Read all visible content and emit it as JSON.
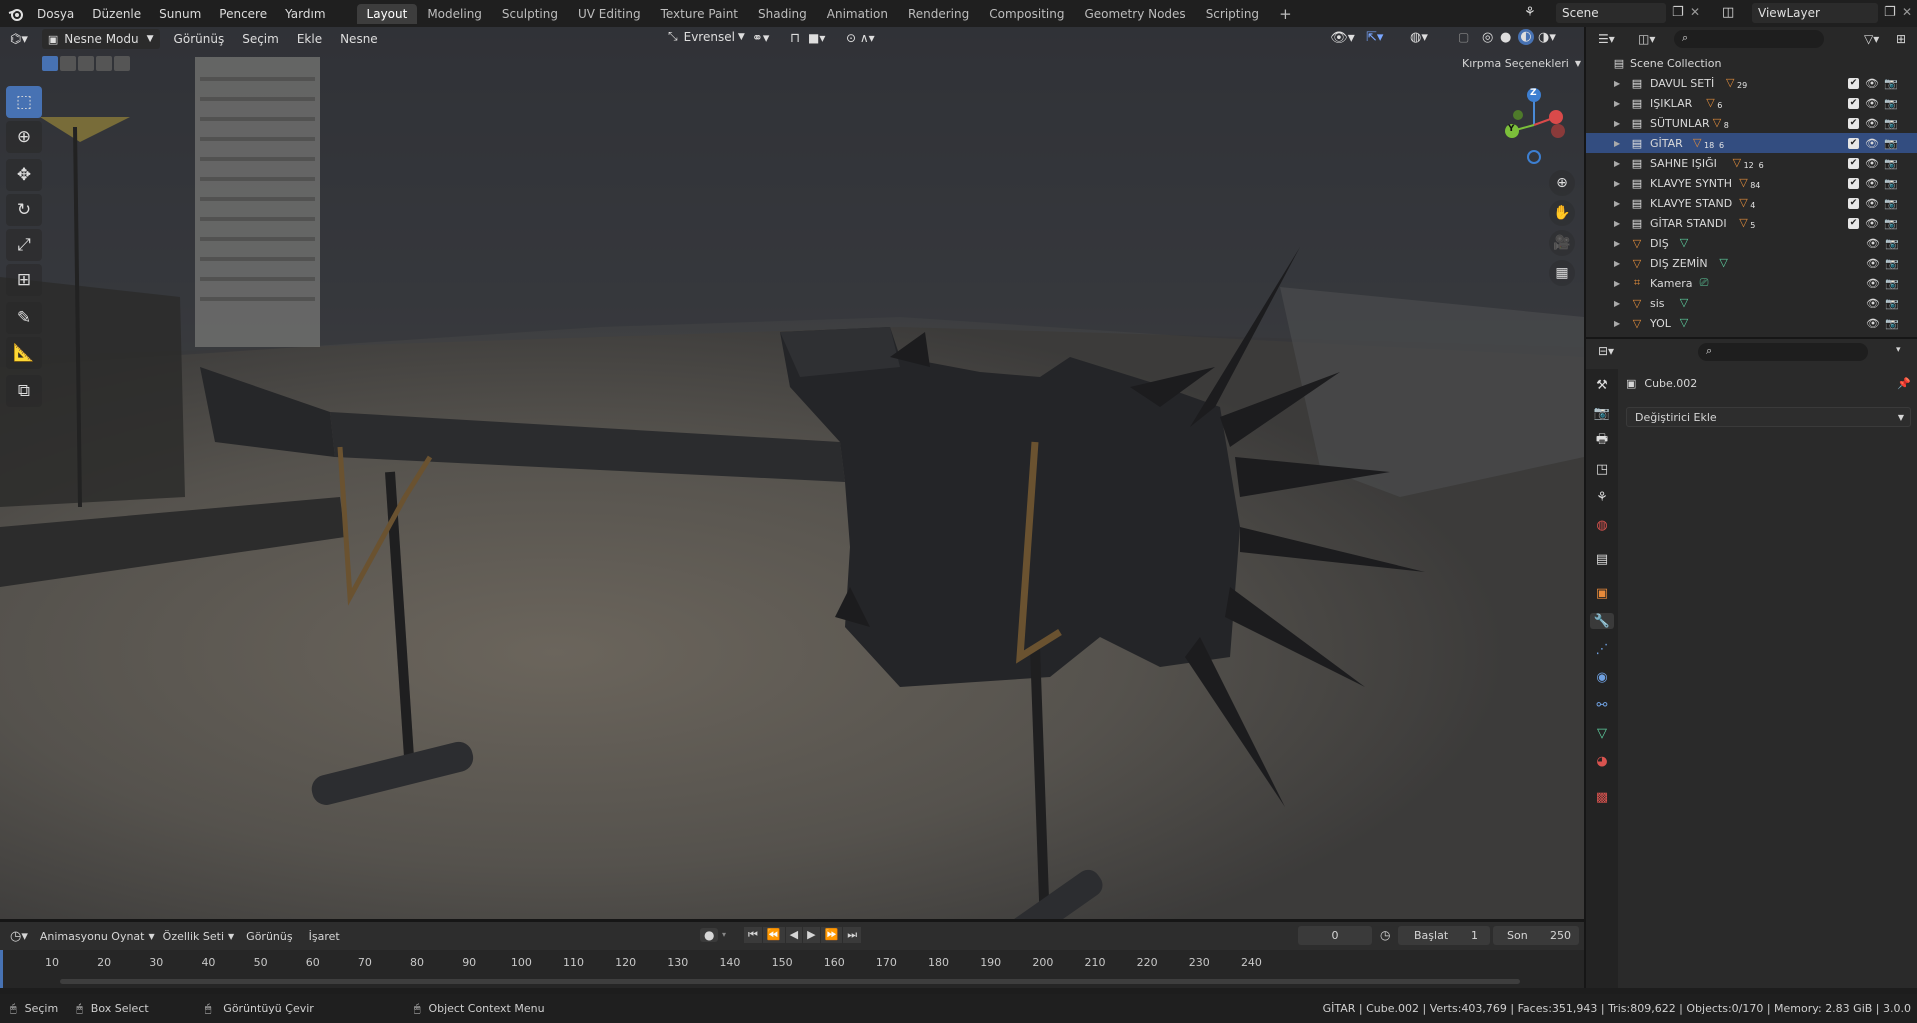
{
  "topbar": {
    "menus": [
      "Dosya",
      "Düzenle",
      "Sunum",
      "Pencere",
      "Yardım"
    ],
    "workspaces": [
      "Layout",
      "Modeling",
      "Sculpting",
      "UV Editing",
      "Texture Paint",
      "Shading",
      "Animation",
      "Rendering",
      "Compositing",
      "Geometry Nodes",
      "Scripting"
    ],
    "active_workspace": "Layout",
    "add_tab": "+",
    "scene": "Scene",
    "view_layer": "ViewLayer"
  },
  "viewport_header": {
    "mode": "Nesne Modu",
    "menus": [
      "Görünüş",
      "Seçim",
      "Ekle",
      "Nesne"
    ],
    "transform_orientation": "Evrensel",
    "clipping_options": "Kırpma Seçenekleri"
  },
  "gizmo": {
    "z": "Z",
    "y": "Y"
  },
  "outliner": {
    "root": "Scene Collection",
    "items": [
      {
        "name": "DAVUL SETİ",
        "badge": "29",
        "type": "collection"
      },
      {
        "name": "IŞIKLAR",
        "badge": "6",
        "type": "collection"
      },
      {
        "name": "SÜTUNLAR",
        "badge": "8",
        "type": "collection"
      },
      {
        "name": "GİTAR",
        "badge": "18",
        "badge2": "6",
        "type": "collection",
        "selected": true
      },
      {
        "name": "SAHNE IŞIĞI",
        "badge": "12",
        "badge2": "6",
        "type": "collection"
      },
      {
        "name": "KLAVYE SYNTH",
        "badge": "84",
        "type": "collection"
      },
      {
        "name": "KLAVYE STAND",
        "badge": "4",
        "type": "collection"
      },
      {
        "name": "GİTAR STANDI",
        "badge": "5",
        "type": "collection"
      },
      {
        "name": "DIŞ",
        "type": "mesh"
      },
      {
        "name": "DIŞ ZEMİN",
        "type": "mesh"
      },
      {
        "name": "Kamera",
        "type": "camera"
      },
      {
        "name": "sis",
        "type": "mesh"
      },
      {
        "name": "YOL",
        "type": "mesh"
      }
    ]
  },
  "properties": {
    "object_name": "Cube.002",
    "add_modifier": "Değiştirici Ekle"
  },
  "timeline": {
    "menus": [
      "Animasyonu Oynat",
      "Özellik Seti",
      "Görünüş",
      "İşaret"
    ],
    "current_frame": "0",
    "start_label": "Başlat",
    "start": "1",
    "end_label": "Son",
    "end": "250",
    "ticks": [
      "10",
      "20",
      "30",
      "40",
      "50",
      "60",
      "70",
      "80",
      "90",
      "100",
      "110",
      "120",
      "130",
      "140",
      "150",
      "160",
      "170",
      "180",
      "190",
      "200",
      "210",
      "220",
      "230",
      "240"
    ]
  },
  "status": {
    "select": "Seçim",
    "box_select": "Box Select",
    "rotate_view": "Görüntüyü Çevir",
    "context_menu": "Object Context Menu",
    "stats": "GİTAR | Cube.002 | Verts:403,769 | Faces:351,943 | Tris:809,622 | Objects:0/170 | Memory: 2.83 GiB | 3.0.0"
  },
  "colors": {
    "accent": "#4772b3",
    "selected_row": "#334d80",
    "collection_badge": "#e08c3c",
    "mesh_icon": "#5fd0a0"
  }
}
